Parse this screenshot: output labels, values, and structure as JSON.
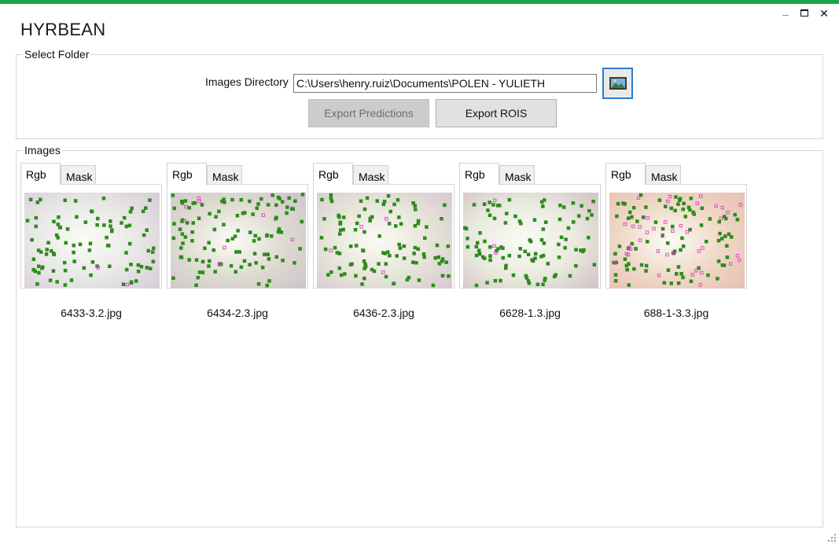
{
  "app": {
    "title": "HYRBEAN"
  },
  "window_controls": {
    "minimize": "_",
    "close": "✕"
  },
  "select_folder": {
    "group_label": "Select Folder",
    "directory_label": "Images Directory",
    "directory_value": "C:\\Users\\henry.ruiz\\Documents\\POLEN - YULIETH",
    "browse_icon": "image-folder-icon",
    "export_predictions_label": "Export Predictions",
    "export_predictions_enabled": false,
    "export_rois_label": "Export ROIS"
  },
  "images": {
    "group_label": "Images",
    "tab_labels": {
      "rgb": "Rgb",
      "mask": "Mask"
    },
    "items": [
      {
        "filename": "6433-3.2.jpg",
        "active_tab": "Rgb",
        "bg": "#e8e8e6",
        "tint": "#d9cfd9",
        "green": 95,
        "pink": 2
      },
      {
        "filename": "6434-2.3.jpg",
        "active_tab": "Rgb",
        "bg": "#dedbd0",
        "tint": "#cfc6cc",
        "green": 110,
        "pink": 8
      },
      {
        "filename": "6436-2.3.jpg",
        "active_tab": "Rgb",
        "bg": "#e6e5d8",
        "tint": "#d8ccd2",
        "green": 105,
        "pink": 4
      },
      {
        "filename": "6628-1.3.jpg",
        "active_tab": "Rgb",
        "bg": "#e9eadf",
        "tint": "#d4c6c8",
        "green": 100,
        "pink": 3
      },
      {
        "filename": "688-1-3.3.jpg",
        "active_tab": "Rgb",
        "bg": "#efd8c6",
        "tint": "#e8c2b4",
        "green": 90,
        "pink": 40
      }
    ]
  },
  "colors": {
    "accent_bar": "#1aa34a",
    "focus_border": "#2b7bd1",
    "dot_green": "#2e8b1e",
    "dot_pink": "#e040c8"
  }
}
